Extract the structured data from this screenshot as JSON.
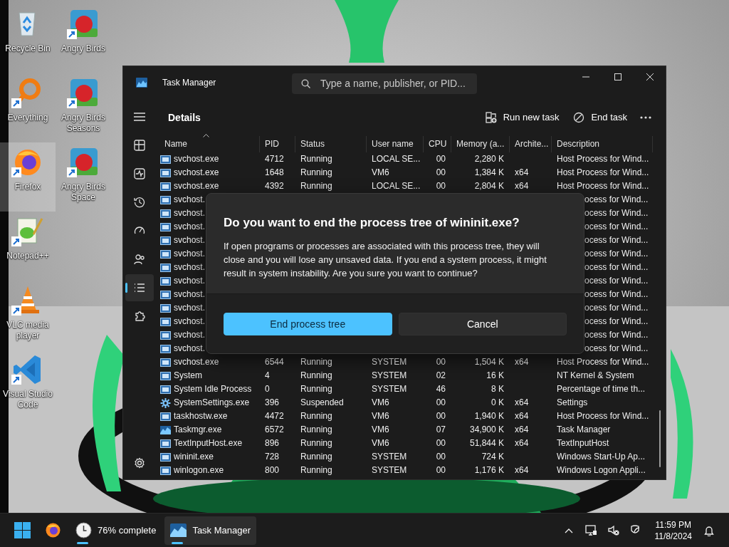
{
  "desktop_icons": [
    [
      {
        "label": "Recycle Bin",
        "kind": "recycle",
        "shortcut": false,
        "selected": false
      },
      {
        "label": "Everything",
        "kind": "magnifier",
        "shortcut": true,
        "selected": false
      },
      {
        "label": "Firefox",
        "kind": "browser",
        "shortcut": true,
        "selected": true
      },
      {
        "label": "Notepad++",
        "kind": "notepad",
        "shortcut": true,
        "selected": false
      },
      {
        "label": "VLC media player",
        "kind": "cone",
        "shortcut": true,
        "selected": false
      },
      {
        "label": "Visual Studio Code",
        "kind": "ribbon",
        "shortcut": true,
        "selected": false
      }
    ],
    [
      {
        "label": "Angry Birds",
        "kind": "tile",
        "shortcut": true,
        "selected": false
      },
      {
        "label": "Angry Birds Seasons",
        "kind": "tile",
        "shortcut": true,
        "selected": false
      },
      {
        "label": "Angry Birds Space",
        "kind": "tile",
        "shortcut": true,
        "selected": false
      }
    ]
  ],
  "window": {
    "title": "Task Manager",
    "search": {
      "placeholder": "Type a name, publisher, or PID..."
    },
    "nav": [
      {
        "kind": "processes",
        "selected": false
      },
      {
        "kind": "performance",
        "selected": false
      },
      {
        "kind": "history",
        "selected": false
      },
      {
        "kind": "startup",
        "selected": false
      },
      {
        "kind": "users",
        "selected": false
      },
      {
        "kind": "details",
        "selected": true
      },
      {
        "kind": "services",
        "selected": false
      }
    ],
    "page_title": "Details",
    "actions": [
      {
        "kind": "run",
        "label": "Run new task"
      },
      {
        "kind": "end",
        "label": "End task"
      }
    ],
    "table": {
      "columns": [
        {
          "label": "Name",
          "sorted": true
        },
        {
          "label": "PID",
          "sorted": false
        },
        {
          "label": "Status",
          "sorted": false
        },
        {
          "label": "User name",
          "sorted": false
        },
        {
          "label": "CPU",
          "sorted": false
        },
        {
          "label": "Memory (a...",
          "sorted": false
        },
        {
          "label": "Archite...",
          "sorted": false
        },
        {
          "label": "Description",
          "sorted": false
        }
      ],
      "rows": [
        {
          "kind": "service",
          "covered": false,
          "name": "svchost.exe",
          "pid": "4712",
          "status": "Running",
          "user": "LOCAL SE...",
          "cpu": "00",
          "memory": "2,280 K",
          "description": "Host Process for Wind..."
        },
        {
          "kind": "service",
          "covered": false,
          "name": "svchost.exe",
          "pid": "1648",
          "status": "Running",
          "user": "VM6",
          "cpu": "00",
          "memory": "1,384 K",
          "arch": "x64",
          "description": "Host Process for Wind..."
        },
        {
          "kind": "service",
          "covered": false,
          "name": "svchost.exe",
          "pid": "4392",
          "status": "Running",
          "user": "LOCAL SE...",
          "cpu": "00",
          "memory": "2,804 K",
          "arch": "x64",
          "description": "Host Process for Wind..."
        },
        {
          "kind": "service",
          "covered": true,
          "name": "svchost.",
          "description": "ocess for Wind..."
        },
        {
          "kind": "service",
          "covered": true,
          "name": "svchost.",
          "description": "ocess for Wind..."
        },
        {
          "kind": "service",
          "covered": true,
          "name": "svchost.",
          "description": "ocess for Wind..."
        },
        {
          "kind": "service",
          "covered": true,
          "name": "svchost.",
          "description": "ocess for Wind..."
        },
        {
          "kind": "service",
          "covered": true,
          "name": "svchost.",
          "description": "ocess for Wind..."
        },
        {
          "kind": "service",
          "covered": true,
          "name": "svchost.",
          "description": "ocess for Wind..."
        },
        {
          "kind": "service",
          "covered": true,
          "name": "svchost.",
          "description": "ocess for Wind..."
        },
        {
          "kind": "service",
          "covered": true,
          "name": "svchost.",
          "description": "ocess for Wind..."
        },
        {
          "kind": "service",
          "covered": true,
          "name": "svchost.",
          "description": "ocess for Wind..."
        },
        {
          "kind": "service",
          "covered": true,
          "name": "svchost.",
          "description": "ocess for Wind..."
        },
        {
          "kind": "service",
          "covered": true,
          "name": "svchost.",
          "description": "ocess for Wind..."
        },
        {
          "kind": "service",
          "covered": true,
          "name": "svchost.",
          "description": "ocess for Wind..."
        },
        {
          "kind": "service",
          "covered": false,
          "name": "svchost.exe",
          "pid": "6544",
          "status": "Running",
          "user": "SYSTEM",
          "cpu": "00",
          "memory": "1,504 K",
          "arch": "x64",
          "description": "Host Process for Wind..."
        },
        {
          "kind": "service",
          "covered": false,
          "name": "System",
          "pid": "4",
          "status": "Running",
          "user": "SYSTEM",
          "cpu": "02",
          "memory": "16 K",
          "description": "NT Kernel & System"
        },
        {
          "kind": "service",
          "covered": false,
          "name": "System Idle Process",
          "pid": "0",
          "status": "Running",
          "user": "SYSTEM",
          "cpu": "46",
          "memory": "8 K",
          "description": "Percentage of time th..."
        },
        {
          "kind": "gear",
          "covered": false,
          "name": "SystemSettings.exe",
          "pid": "396",
          "status": "Suspended",
          "user": "VM6",
          "cpu": "00",
          "memory": "0 K",
          "arch": "x64",
          "description": "Settings"
        },
        {
          "kind": "service",
          "covered": false,
          "name": "taskhostw.exe",
          "pid": "4472",
          "status": "Running",
          "user": "VM6",
          "cpu": "00",
          "memory": "1,940 K",
          "arch": "x64",
          "description": "Host Process for Wind..."
        },
        {
          "kind": "chart",
          "covered": false,
          "name": "Taskmgr.exe",
          "pid": "6572",
          "status": "Running",
          "user": "VM6",
          "cpu": "07",
          "memory": "34,900 K",
          "arch": "x64",
          "description": "Task Manager"
        },
        {
          "kind": "service",
          "covered": false,
          "name": "TextInputHost.exe",
          "pid": "896",
          "status": "Running",
          "user": "VM6",
          "cpu": "00",
          "memory": "51,844 K",
          "arch": "x64",
          "description": "TextInputHost"
        },
        {
          "kind": "service",
          "covered": false,
          "name": "wininit.exe",
          "pid": "728",
          "status": "Running",
          "user": "SYSTEM",
          "cpu": "00",
          "memory": "724 K",
          "description": "Windows Start-Up Ap..."
        },
        {
          "kind": "service",
          "covered": false,
          "name": "winlogon.exe",
          "pid": "800",
          "status": "Running",
          "user": "SYSTEM",
          "cpu": "00",
          "memory": "1,176 K",
          "arch": "x64",
          "description": "Windows Logon Appli..."
        }
      ]
    }
  },
  "dialog": {
    "title": "Do you want to end the process tree of wininit.exe?",
    "message": "If open programs or processes are associated with this process tree, they will close and you will lose any unsaved data. If you end a system process, it might result in system instability. Are you sure you want to continue?",
    "buttons": [
      {
        "label": "End process tree",
        "primary": true
      },
      {
        "label": "Cancel",
        "primary": false
      }
    ]
  },
  "taskbar": {
    "apps": [
      {
        "kind": "start",
        "running": false,
        "active": false
      },
      {
        "kind": "browser",
        "running": false,
        "active": false
      },
      {
        "kind": "clock",
        "label": "76% complete",
        "running": true,
        "active": false
      },
      {
        "kind": "chart",
        "label": "Task Manager",
        "running": true,
        "active": true
      }
    ],
    "tray": [
      {
        "kind": "chevron"
      },
      {
        "kind": "network"
      },
      {
        "kind": "volume"
      },
      {
        "kind": "shield"
      }
    ],
    "time": "11:59 PM",
    "date": "11/8/2024"
  }
}
